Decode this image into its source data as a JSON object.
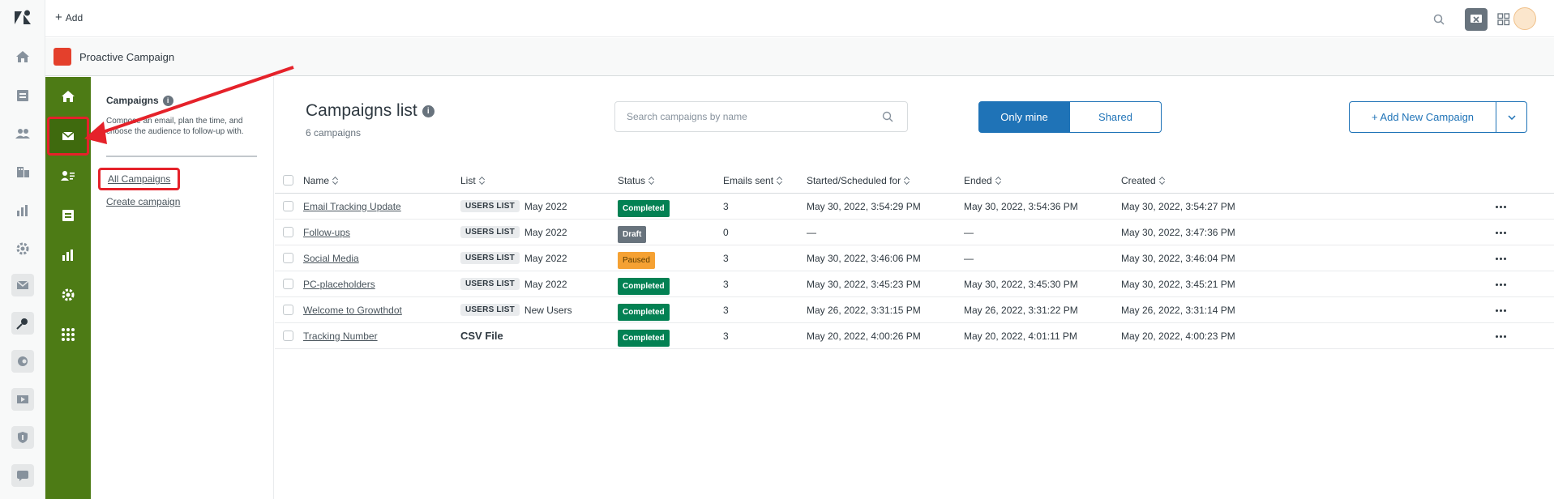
{
  "topbar": {
    "add_label": "Add"
  },
  "app": {
    "title": "Proactive Campaign"
  },
  "sidepanel": {
    "title": "Campaigns",
    "description": "Compose an email, plan the time, and choose the audience to follow-up with.",
    "links": [
      "All Campaigns",
      "Create campaign"
    ]
  },
  "main": {
    "title": "Campaigns list",
    "subtitle": "6 campaigns",
    "search_placeholder": "Search campaigns by name",
    "toggle": {
      "on": "Only mine",
      "off": "Shared"
    },
    "add_button": "+ Add New Campaign"
  },
  "table": {
    "columns": [
      "Name",
      "List",
      "Status",
      "Emails sent",
      "Started/Scheduled for",
      "Ended",
      "Created"
    ],
    "rows": [
      {
        "name": "Email Tracking Update",
        "list_tag": "USERS LIST",
        "list": "May 2022",
        "status": "Completed",
        "status_kind": "completed",
        "sent": "3",
        "started": "May 30, 2022, 3:54:29 PM",
        "ended": "May 30, 2022, 3:54:36 PM",
        "created": "May 30, 2022, 3:54:27 PM"
      },
      {
        "name": "Follow-ups",
        "list_tag": "USERS LIST",
        "list": "May 2022",
        "status": "Draft",
        "status_kind": "draft",
        "sent": "0",
        "started": "—",
        "ended": "—",
        "created": "May 30, 2022, 3:47:36 PM"
      },
      {
        "name": "Social Media",
        "list_tag": "USERS LIST",
        "list": "May 2022",
        "status": "Paused",
        "status_kind": "paused",
        "sent": "3",
        "started": "May 30, 2022, 3:46:06 PM",
        "ended": "—",
        "created": "May 30, 2022, 3:46:04 PM"
      },
      {
        "name": "PC-placeholders",
        "list_tag": "USERS LIST",
        "list": "May 2022",
        "status": "Completed",
        "status_kind": "completed",
        "sent": "3",
        "started": "May 30, 2022, 3:45:23 PM",
        "ended": "May 30, 2022, 3:45:30 PM",
        "created": "May 30, 2022, 3:45:21 PM"
      },
      {
        "name": "Welcome to Growthdot",
        "list_tag": "USERS LIST",
        "list": "New Users",
        "status": "Completed",
        "status_kind": "completed",
        "sent": "3",
        "started": "May 26, 2022, 3:31:15 PM",
        "ended": "May 26, 2022, 3:31:22 PM",
        "created": "May 26, 2022, 3:31:14 PM"
      },
      {
        "name": "Tracking Number",
        "list_tag": "",
        "list": "CSV File",
        "status": "Completed",
        "status_kind": "completed",
        "sent": "3",
        "started": "May 20, 2022, 4:00:26 PM",
        "ended": "May 20, 2022, 4:01:11 PM",
        "created": "May 20, 2022, 4:00:23 PM"
      }
    ]
  },
  "colors": {
    "nav_green": "#4d7b15",
    "accent_blue": "#1f73b7",
    "annotation_red": "#e5222a"
  }
}
